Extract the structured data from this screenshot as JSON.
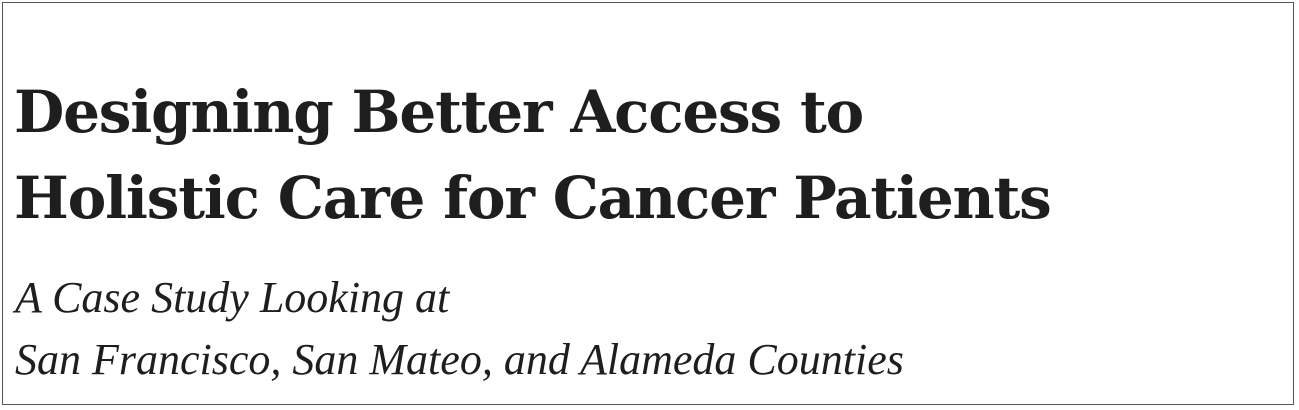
{
  "title": {
    "line1": "Designing Better Access to",
    "line2": "Holistic Care for Cancer Patients"
  },
  "subtitle": {
    "line1": "A Case Study Looking at",
    "line2": "San Francisco, San Mateo, and Alameda Counties"
  },
  "colors": {
    "text": "#1e1e1e",
    "border": "#555555",
    "background": "#ffffff"
  }
}
